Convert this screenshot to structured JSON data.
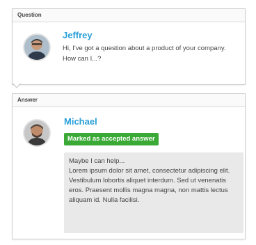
{
  "question": {
    "header": "Question",
    "name": "Jeffrey",
    "message": "Hi, I've got a question about a product of your company. How can I...?"
  },
  "answer": {
    "header": "Answer",
    "name": "Michael",
    "badge": "Marked as accepted answer",
    "intro": "Maybe I can help...",
    "body": "Lorem ipsum dolor sit amet, consectetur adipiscing elit. Vestibulum lobortis aliquet interdum. Sed ut venenatis eros. Praesent mollis magna magna, non mattis lectus aliquam id. Nulla facilisi."
  },
  "colors": {
    "name": "#2a9fd8",
    "badge": "#3aa935",
    "answer_bg": "#e9e9e9"
  },
  "icons": {
    "question_avatar": "user-avatar-icon",
    "answer_avatar": "user-avatar-icon"
  }
}
